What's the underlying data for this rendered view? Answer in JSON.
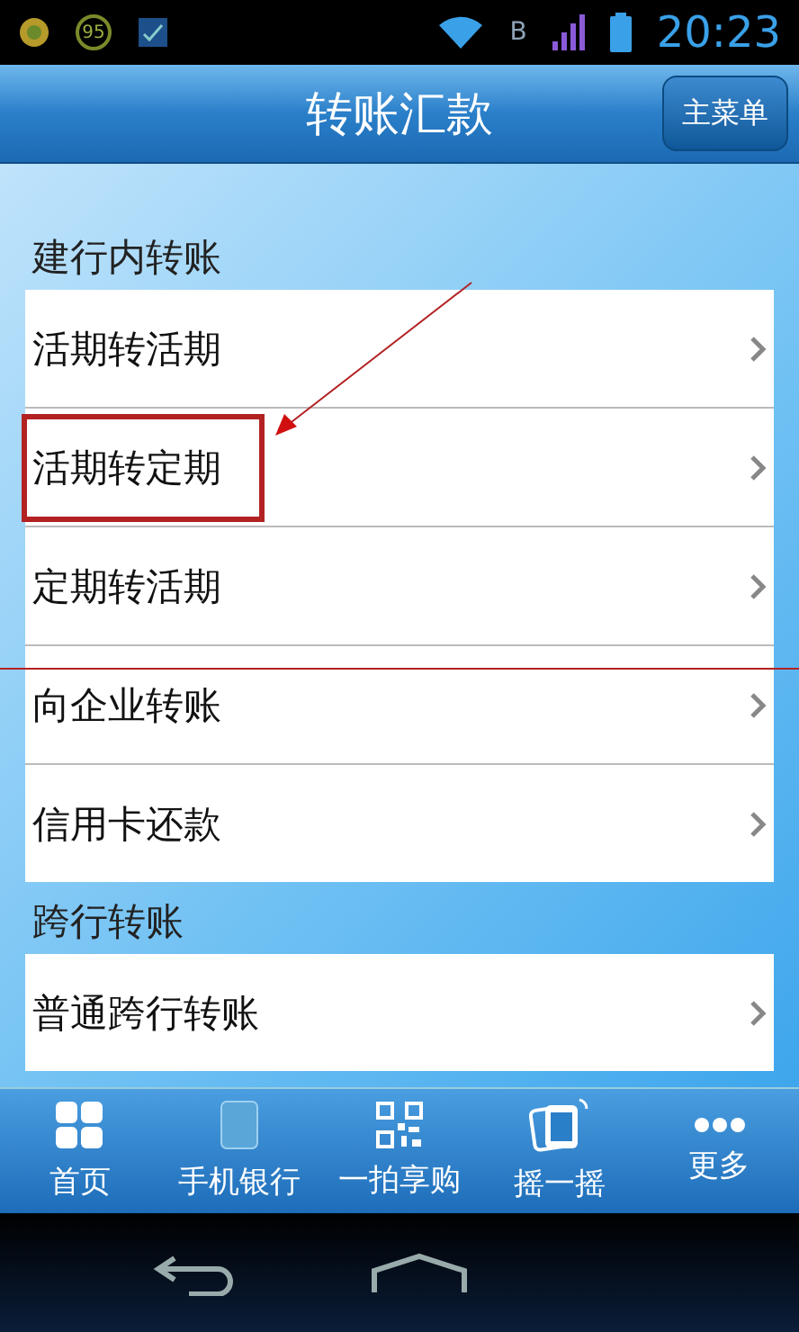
{
  "status_bar": {
    "badge": "95",
    "network": "B",
    "time": "20:23"
  },
  "header": {
    "title": "转账汇款",
    "menu_button": "主菜单"
  },
  "sections": [
    {
      "title": "建行内转账",
      "items": [
        {
          "label": "活期转活期",
          "highlighted": false
        },
        {
          "label": "活期转定期",
          "highlighted": true
        },
        {
          "label": "定期转活期",
          "highlighted": false
        },
        {
          "label": "向企业转账",
          "highlighted": false
        },
        {
          "label": "信用卡还款",
          "highlighted": false
        }
      ]
    },
    {
      "title": "跨行转账",
      "items": [
        {
          "label": "普通跨行转账",
          "highlighted": false
        }
      ]
    }
  ],
  "tab_bar": [
    {
      "kind": "grid",
      "label": "首页"
    },
    {
      "kind": "phone",
      "label": "手机银行"
    },
    {
      "kind": "qr",
      "label": "一拍享购"
    },
    {
      "kind": "shake",
      "label": "摇一摇"
    },
    {
      "kind": "more",
      "label": "更多"
    }
  ]
}
